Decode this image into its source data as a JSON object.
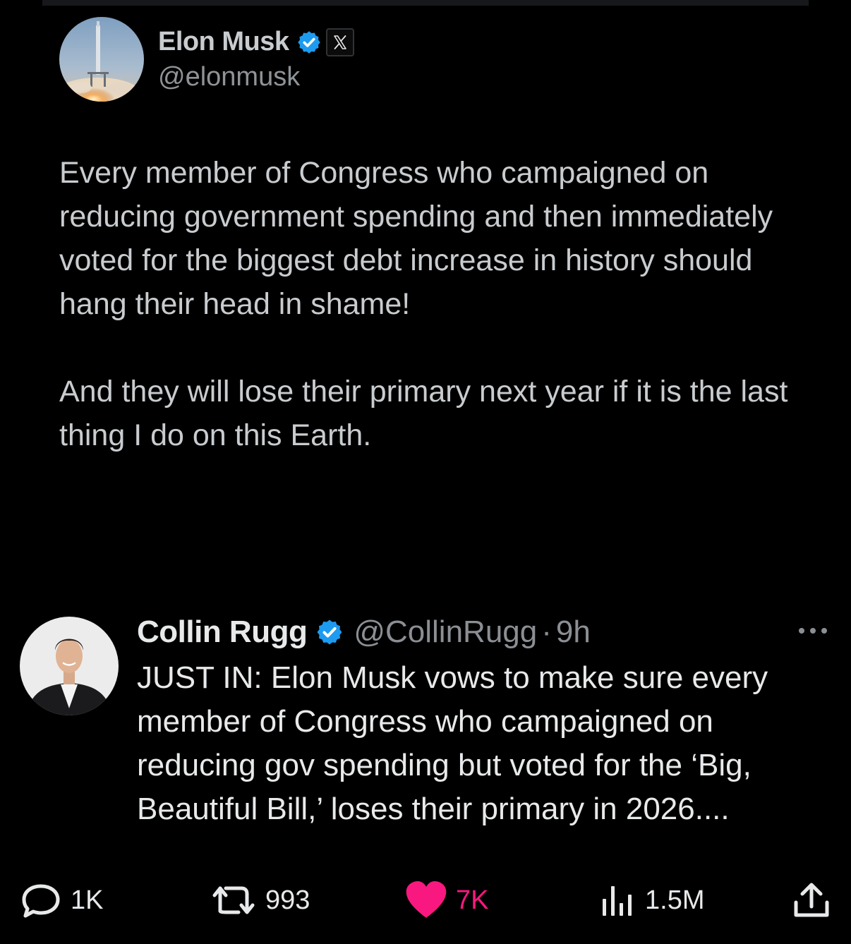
{
  "quoted_tweet": {
    "author_name": "Elon Musk",
    "author_handle": "@elonmusk",
    "verified": true,
    "affiliate_badge": "X",
    "paragraphs": [
      "Every member of Congress who campaigned on reducing government spending and then immediately voted for the biggest debt increase in history should hang their head in shame!",
      "And they will lose their primary next year if it is the last thing I do on this Earth."
    ]
  },
  "reply_tweet": {
    "author_name": "Collin Rugg",
    "author_handle": "@CollinRugg",
    "separator": "·",
    "time": "9h",
    "verified": true,
    "text": "JUST IN: Elon Musk vows to make sure every member of Congress who campaigned on reducing gov spending but voted for the ‘Big, Beautiful Bill,’ loses their primary in 2026...."
  },
  "actions": {
    "replies": "1K",
    "retweets": "993",
    "likes": "7K",
    "views": "1.5M"
  },
  "icons": {
    "verified": "verified-badge-icon",
    "more": "more-options-icon",
    "reply": "reply-icon",
    "retweet": "retweet-icon",
    "like": "heart-icon",
    "views": "views-icon",
    "share": "share-icon"
  },
  "colors": {
    "background": "#000000",
    "text_primary": "#e7e9ea",
    "text_secondary": "#8b8f93",
    "verified_blue": "#1d9bf0",
    "like_pink": "#f91880"
  }
}
